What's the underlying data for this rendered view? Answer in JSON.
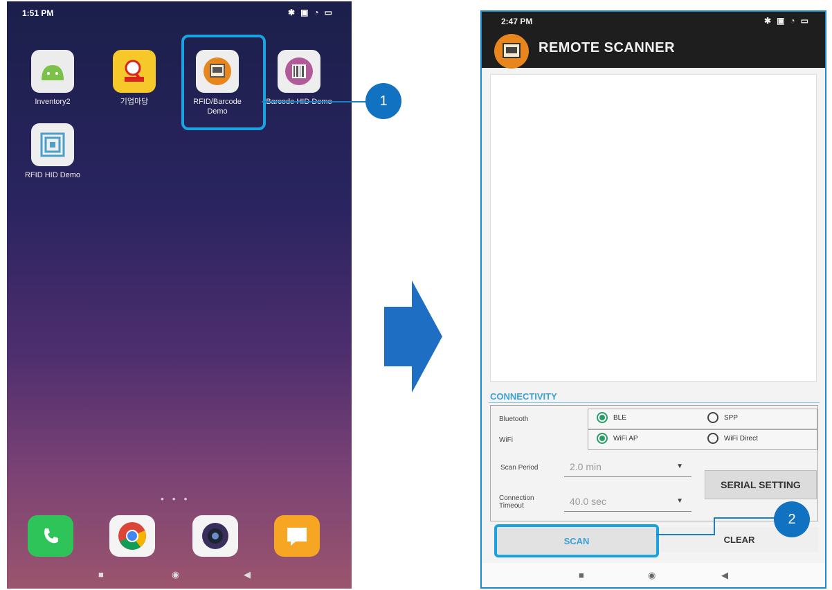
{
  "left_phone": {
    "status": {
      "time": "1:51 PM",
      "icons": [
        "bluetooth-icon",
        "nfc-icon",
        "wifi-icon",
        "battery-icon"
      ]
    },
    "apps": [
      {
        "label": "Inventory2",
        "icon": "android-icon",
        "color": "#7cc24a"
      },
      {
        "label": "기업마당",
        "icon": "biz-search-icon",
        "color": "#f7c82a"
      },
      {
        "label": "RFID/Barcode Demo",
        "icon": "scanner-icon",
        "color": "#e8861e"
      },
      {
        "label": "Barcode HID Demo",
        "icon": "barcode-icon",
        "color": "#b05a9a"
      },
      {
        "label": "RFID HID Demo",
        "icon": "rfid-icon",
        "color": "#4aa0c8"
      }
    ],
    "page_dots": "• • •",
    "dock": [
      "phone-icon",
      "chrome-icon",
      "camera-icon",
      "messages-icon"
    ],
    "nav": [
      "■",
      "◉",
      "◀"
    ]
  },
  "callouts": {
    "one": "1",
    "two": "2"
  },
  "right_phone": {
    "status": {
      "time": "2:47 PM",
      "icons": [
        "bluetooth-icon",
        "nfc-icon",
        "wifi-icon",
        "battery-icon"
      ]
    },
    "title": "REMOTE SCANNER",
    "connectivity": {
      "label": "CONNECTIVITY",
      "bluetooth": {
        "label": "Bluetooth",
        "options": [
          "BLE",
          "SPP"
        ],
        "selected": "BLE"
      },
      "wifi": {
        "label": "WiFi",
        "options": [
          "WiFi AP",
          "WiFi Direct"
        ],
        "selected": "WiFi AP"
      },
      "scan_period": {
        "label": "Scan Period",
        "value": "2.0 min"
      },
      "connection_timeout": {
        "label": "Connection Timeout",
        "value": "40.0 sec"
      },
      "serial_setting": "SERIAL SETTING"
    },
    "scan_label": "SCAN",
    "clear_label": "CLEAR",
    "nav": [
      "■",
      "◉",
      "◀"
    ]
  },
  "colors": {
    "highlight": "#1aa3e0",
    "callout": "#1272c2",
    "accent": "#3aa0d6",
    "radio_on": "#2a9d6a"
  }
}
